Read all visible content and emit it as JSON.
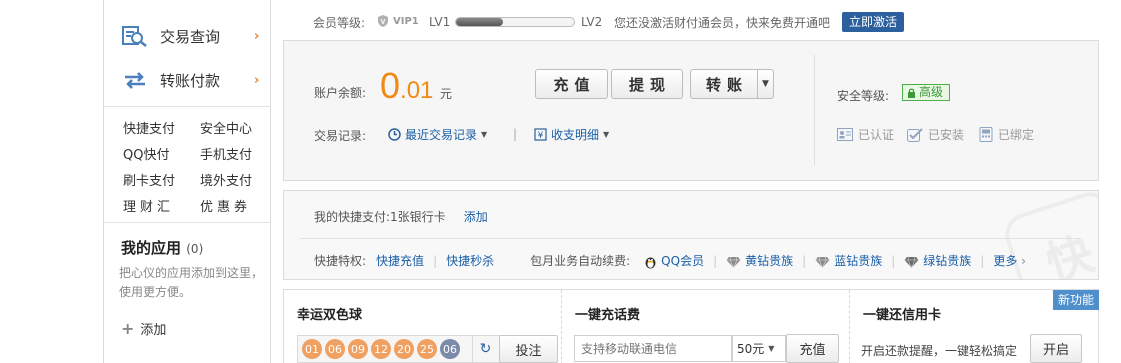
{
  "sidebar": {
    "nav": [
      {
        "label": "交易查询",
        "icon": "search-record-icon"
      },
      {
        "label": "转账付款",
        "icon": "transfer-arrows-icon"
      }
    ],
    "arrow": "›",
    "quick_links": [
      "快捷支付",
      "安全中心",
      "QQ快付",
      "手机支付",
      "刷卡支付",
      "境外支付",
      "理财汇",
      "优惠券"
    ],
    "my_apps": {
      "title": "我的应用",
      "count": "(0)",
      "description": "把心仪的应用添加到这里，使用更方便。",
      "add_label": "添加"
    }
  },
  "member": {
    "label": "会员等级:",
    "vip": "VIP1",
    "lv_from": "LV1",
    "lv_to": "LV2",
    "progress": 0.4,
    "tip": "您还没激活财付通会员，快来免费开通吧",
    "activate_label": "立即激活"
  },
  "account": {
    "balance_label": "账户余额:",
    "balance_int": "0",
    "balance_dec": ".01",
    "balance_unit": "元",
    "buttons": {
      "recharge": "充值",
      "withdraw": "提现",
      "transfer": "转账",
      "dropdown": "▼"
    },
    "trade_record_label": "交易记录:",
    "recent_trades": "最近交易记录",
    "income_detail": "收支明细",
    "separator": "|",
    "security_label": "安全等级:",
    "security_level": "高级",
    "security_color": "#3a9a36",
    "statuses": [
      "已认证",
      "已安装",
      "已绑定"
    ]
  },
  "quickpay": {
    "label": "我的快捷支付:",
    "cards": "1张银行卡",
    "add": "添加",
    "privilege_label": "快捷特权:",
    "privileges": [
      "快捷充值",
      "快捷秒杀"
    ],
    "auto_renew_label": "包月业务自动续费:",
    "services": [
      {
        "label": "QQ会员",
        "icon": "penguin-icon"
      },
      {
        "label": "黄钻贵族",
        "icon": "diamond-icon",
        "color": "#888888"
      },
      {
        "label": "蓝钻贵族",
        "icon": "diamond-icon",
        "color": "#888888"
      },
      {
        "label": "绿钻贵族",
        "icon": "diamond-icon",
        "color": "#666666"
      }
    ],
    "more": "更多",
    "watermark": "快"
  },
  "cards": {
    "lottery": {
      "title": "幸运双色球",
      "red_balls": [
        "01",
        "06",
        "09",
        "12",
        "20",
        "25"
      ],
      "blue_ball": "06",
      "bet_label": "投注"
    },
    "phone": {
      "title": "一键充话费",
      "placeholder": "支持移动联通电信",
      "amount": "50元",
      "recharge_label": "充值"
    },
    "credit": {
      "title": "一键还信用卡",
      "badge": "新功能",
      "description": "开启还款提醒，一键轻松搞定",
      "open_label": "开启"
    }
  }
}
